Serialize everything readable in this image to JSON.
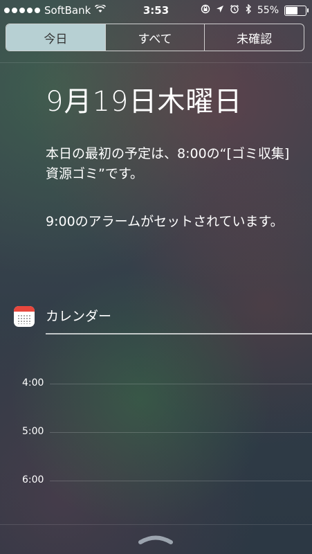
{
  "status_bar": {
    "carrier": "SoftBank",
    "time": "3:53",
    "battery": "55%",
    "battery_level": 0.55,
    "icons": [
      "signal-dots-icon",
      "wifi-icon",
      "rotation-lock-icon",
      "location-icon",
      "alarm-icon",
      "bluetooth-icon",
      "battery-icon"
    ]
  },
  "tabs": [
    {
      "label": "今日",
      "selected": true
    },
    {
      "label": "すべて",
      "selected": false
    },
    {
      "label": "未確認",
      "selected": false
    }
  ],
  "today": {
    "date": "9月19日木曜日",
    "summary": "本日の最初の予定は、8:00の“[ゴミ収集] 資源ゴミ”です。",
    "alarm": "9:00のアラームがセットされています。"
  },
  "calendar": {
    "title": "カレンダー",
    "hours": [
      "4:00",
      "5:00",
      "6:00"
    ]
  },
  "colors": {
    "active_tab": "#b7d0d3",
    "calendar_red": "#e8473d"
  }
}
